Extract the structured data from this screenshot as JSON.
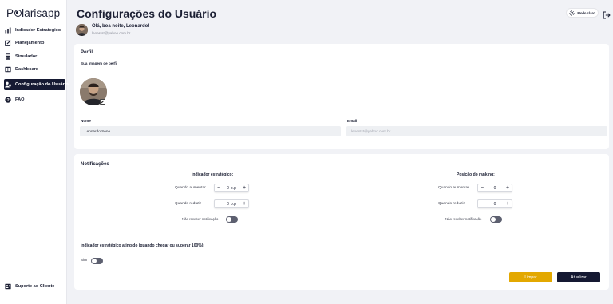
{
  "app": {
    "logo_prefix": "P",
    "logo_suffix": "larisapp"
  },
  "sidebar": {
    "items": [
      {
        "label": "Indicador Estrategico",
        "icon": "bar-chart-icon"
      },
      {
        "label": "Planejamento",
        "icon": "edit-icon"
      },
      {
        "label": "Simulador",
        "icon": "calculator-icon"
      },
      {
        "label": "Dashboard",
        "icon": "dashboard-icon"
      },
      {
        "label": "Configuração do Usuário",
        "icon": "user-settings-icon",
        "active": true
      },
      {
        "label": "FAQ",
        "icon": "help-icon"
      }
    ],
    "support_label": "Suporte ao Cliente"
  },
  "header": {
    "title": "Configurações do Usuário",
    "greeting": "Olá, boa noite, Leonardo!",
    "email": "leoestst@yahoo.com.br",
    "mode_label": "Modo claro"
  },
  "profile": {
    "section_title": "Perfil",
    "image_label": "Sua imagem de perfil",
    "name_label": "Nome",
    "name_value": "Leonardo Sene",
    "email_label": "Email",
    "email_value": "leoestst@yahoo.com.br"
  },
  "notifications": {
    "section_title": "Notificações",
    "left": {
      "title": "Indicador estratégico:",
      "increase_label": "Quando aumentar",
      "increase_value": "0",
      "increase_unit": "p.p",
      "decrease_label": "Quando reduzir",
      "decrease_value": "0",
      "decrease_unit": "p.p",
      "no_notify_label": "Não receber notificação"
    },
    "right": {
      "title": "Posição do ranking:",
      "increase_label": "Quando aumentar",
      "increase_value": "0",
      "decrease_label": "Quando reduzir",
      "decrease_value": "0",
      "no_notify_label": "Não receber notificação"
    },
    "target_title": "Indicador estratégico atingido (quando chegar ou superar 100%):",
    "target_label": "Sim"
  },
  "actions": {
    "clear_label": "Limpar",
    "update_label": "Atualizar"
  },
  "colors": {
    "primary": "#151932",
    "accent": "#e3a800"
  }
}
